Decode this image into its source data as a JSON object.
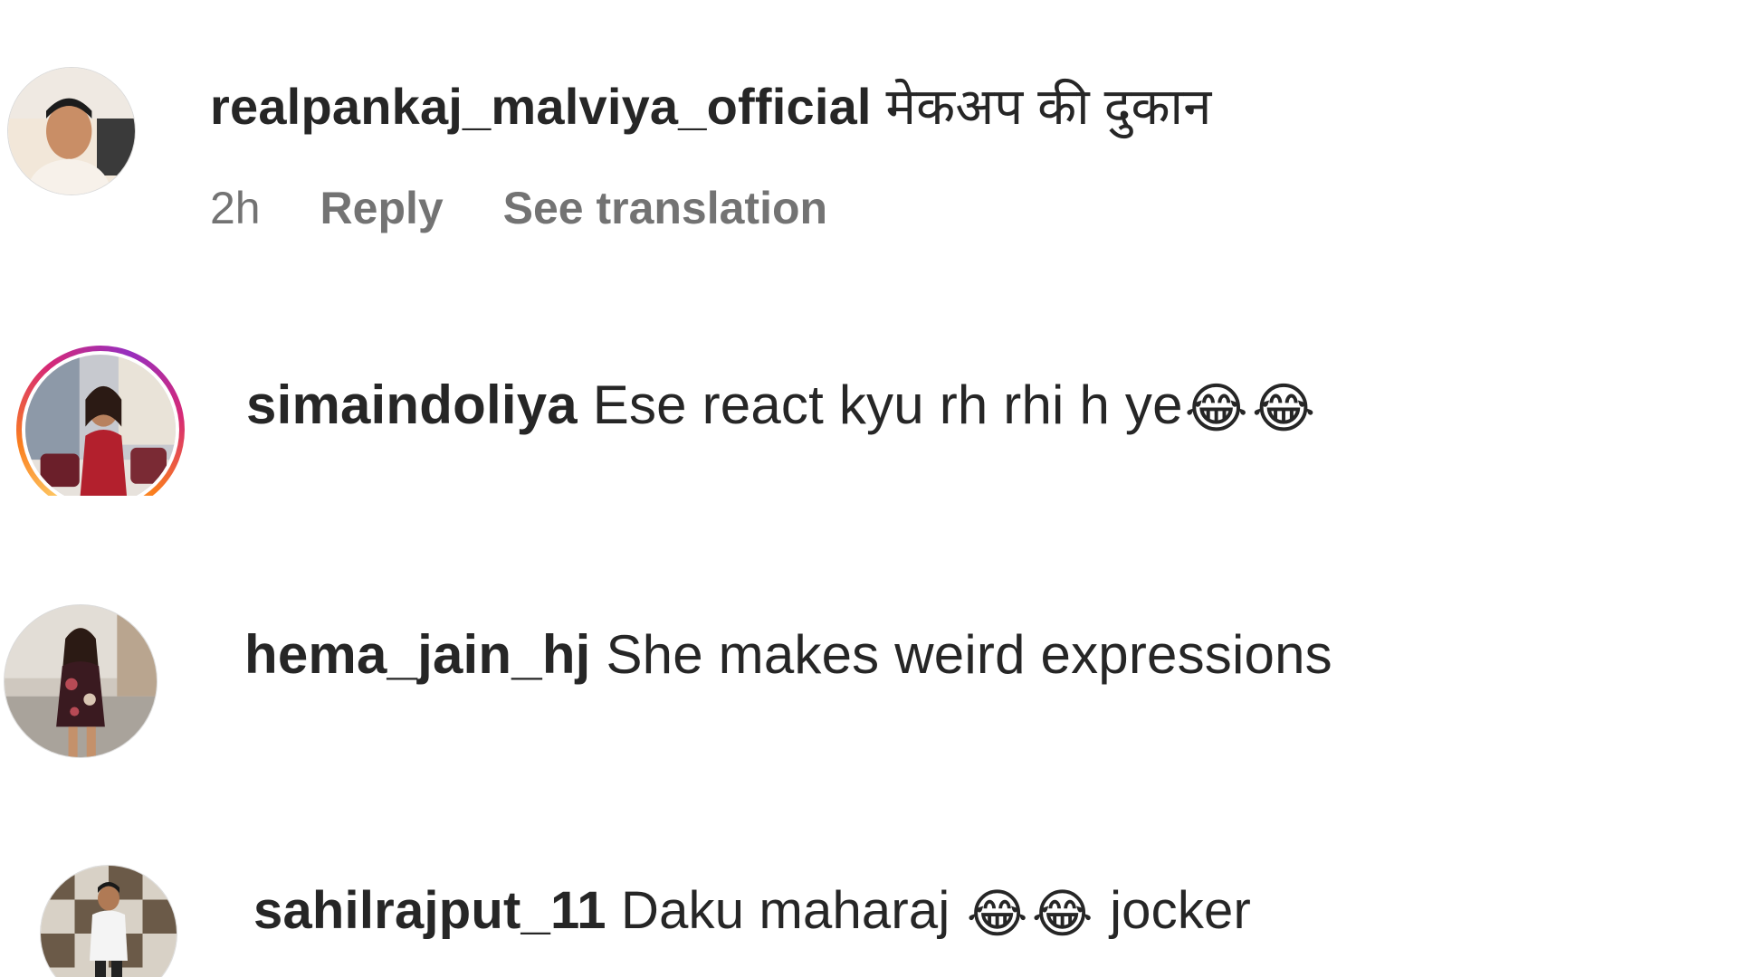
{
  "comments": [
    {
      "username": "realpankaj_malviya_official",
      "text": "मेकअप की दुकान",
      "time": "2h",
      "reply_label": "Reply",
      "translate_label": "See translation",
      "avatar_icon": "avatar-photo-man"
    },
    {
      "username": "simaindoliya",
      "text": "Ese react kyu rh rhi h ye",
      "emojis": [
        "😂",
        "😂"
      ],
      "has_story_ring": true,
      "avatar_icon": "avatar-photo-woman-red-dress"
    },
    {
      "username": "hema_jain_hj",
      "text": "She makes weird expressions",
      "avatar_icon": "avatar-photo-woman-floral-dress"
    },
    {
      "username": "sahilrajput_11",
      "text_before": "Daku maharaj",
      "emojis": [
        "😂",
        "😂"
      ],
      "text_after": "jocker",
      "avatar_icon": "avatar-photo-man-standing"
    }
  ],
  "colors": {
    "text_primary": "#262626",
    "text_secondary": "#737373",
    "story_ring": [
      "#feda75",
      "#fa7e1e",
      "#d62976",
      "#962fbf"
    ]
  }
}
